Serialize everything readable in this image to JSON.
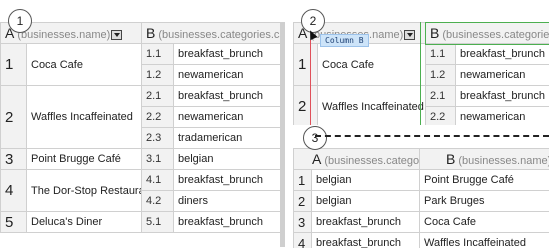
{
  "panel1": {
    "step": "1",
    "col_a": {
      "letter": "A",
      "path": "(businesses.name)"
    },
    "col_b": {
      "letter": "B",
      "path": "(businesses.categories.cate"
    },
    "groups": [
      {
        "num": "1",
        "name": "Coca Cafe",
        "rows": [
          [
            "1.1",
            "breakfast_brunch"
          ],
          [
            "1.2",
            "newamerican"
          ]
        ]
      },
      {
        "num": "2",
        "name": "Waffles Incaffeinated",
        "rows": [
          [
            "2.1",
            "breakfast_brunch"
          ],
          [
            "2.2",
            "newamerican"
          ],
          [
            "2.3",
            "tradamerican"
          ]
        ]
      },
      {
        "num": "3",
        "name": "Point Brugge Café",
        "rows": [
          [
            "3.1",
            "belgian"
          ]
        ]
      },
      {
        "num": "4",
        "name": "The Dor-Stop Restaurant",
        "rows": [
          [
            "4.1",
            "breakfast_brunch"
          ],
          [
            "4.2",
            "diners"
          ]
        ]
      },
      {
        "num": "5",
        "name": "Deluca's Diner",
        "rows": [
          [
            "5.1",
            "breakfast_brunch"
          ]
        ]
      }
    ]
  },
  "panel2": {
    "step": "2",
    "col_a": {
      "letter": "A",
      "path": "(businesses.name)"
    },
    "col_b": {
      "letter": "B",
      "path": "(businesses.categories.cate"
    },
    "tooltip": "Column B",
    "groups": [
      {
        "num": "1",
        "name": "Coca Cafe",
        "rows": [
          [
            "1.1",
            "breakfast_brunch"
          ],
          [
            "1.2",
            "newamerican"
          ]
        ]
      },
      {
        "num": "2",
        "name": "Waffles Incaffeinated",
        "rows": [
          [
            "2.1",
            "breakfast_brunch"
          ],
          [
            "2.2",
            "newamerican"
          ]
        ]
      }
    ]
  },
  "panel3": {
    "step": "3",
    "col_a": {
      "letter": "A",
      "path": "(businesses.categor"
    },
    "col_b": {
      "letter": "B",
      "path": "(businesses.name)"
    },
    "rows": [
      [
        "1",
        "belgian",
        "Point Brugge Café"
      ],
      [
        "2",
        "belgian",
        "Park Bruges"
      ],
      [
        "3",
        "breakfast_brunch",
        "Coca Cafe"
      ],
      [
        "4",
        "breakfast_brunch",
        "Waffles Incaffeinated"
      ]
    ]
  }
}
